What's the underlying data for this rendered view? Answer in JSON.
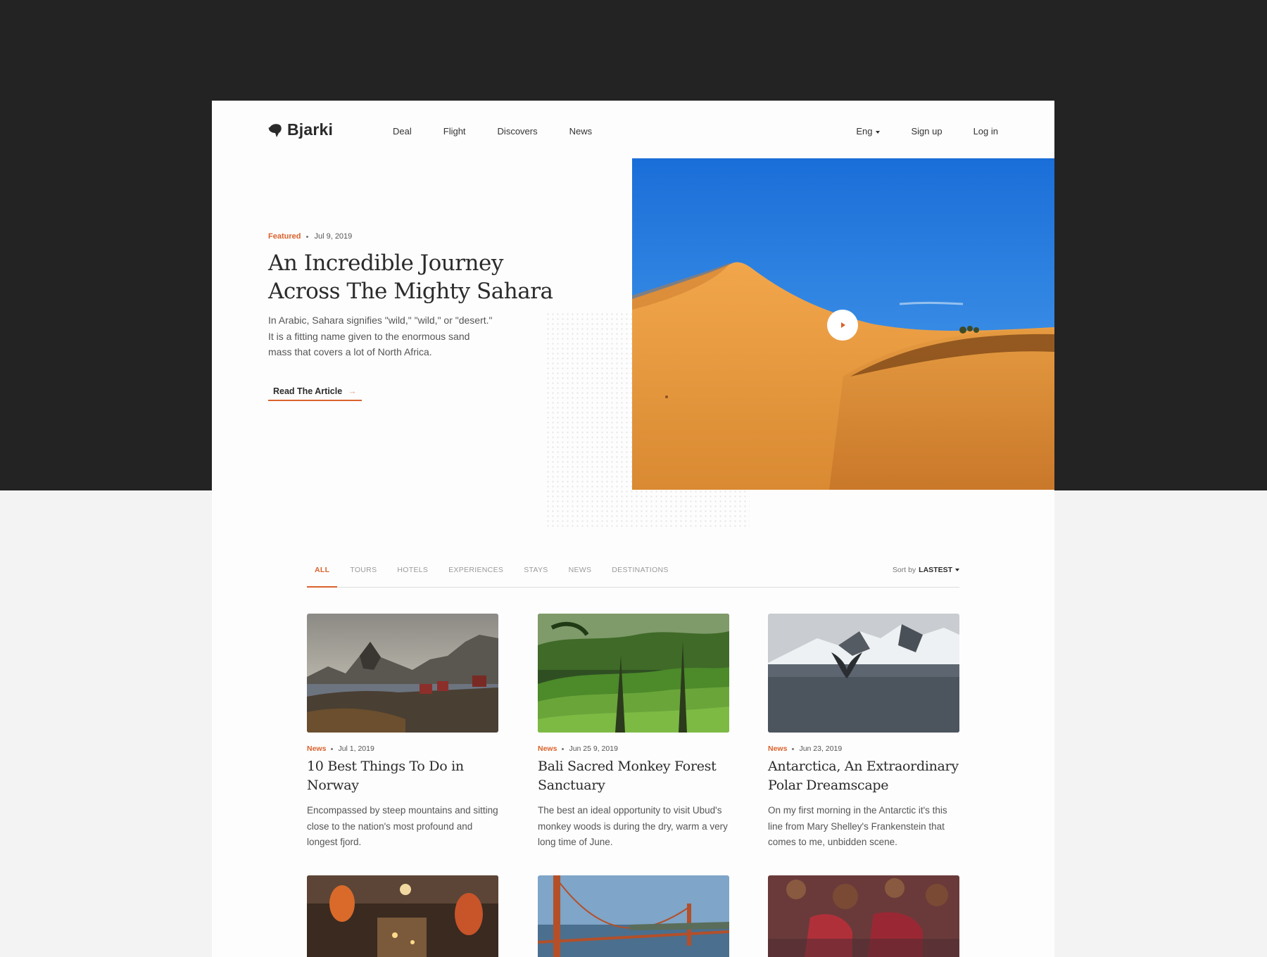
{
  "brand": {
    "name": "Bjarki"
  },
  "nav": {
    "items": [
      "Deal",
      "Flight",
      "Discovers",
      "News"
    ],
    "language": "Eng",
    "signup": "Sign up",
    "login": "Log in"
  },
  "hero": {
    "tag": "Featured",
    "date": "Jul 9, 2019",
    "title": "An Incredible Journey Across The Mighty Sahara",
    "description": "In Arabic, Sahara signifies \"wild,\" \"wild,\" or \"desert.\" It is a fitting name given to the enormous sand mass that covers a lot of North Africa.",
    "cta": "Read The Article",
    "cta_arrow": "→"
  },
  "tabs": {
    "items": [
      "ALL",
      "TOURS",
      "HOTELS",
      "EXPERIENCES",
      "STAYS",
      "NEWS",
      "DESTINATIONS"
    ],
    "sort_label": "Sort by",
    "sort_value": "LASTEST"
  },
  "cards": [
    {
      "tag": "News",
      "date": "Jul 1, 2019",
      "title": "10 Best Things To Do in Norway",
      "description": "Encompassed by steep mountains and sitting close to the nation's most profound and longest fjord."
    },
    {
      "tag": "News",
      "date": "Jun 25 9, 2019",
      "title": "Bali Sacred Monkey Forest Sanctuary",
      "description": "The best an ideal opportunity to visit Ubud's monkey woods is during the dry, warm a very long time of June."
    },
    {
      "tag": "News",
      "date": "Jun 23, 2019",
      "title": "Antarctica, An Extraordinary Polar Dreamscape",
      "description": "On my first morning in the Antarctic it's this line from Mary Shelley's Frankenstein that comes to me, unbidden scene."
    }
  ],
  "colors": {
    "accent": "#d9622b",
    "dark": "#232323"
  }
}
